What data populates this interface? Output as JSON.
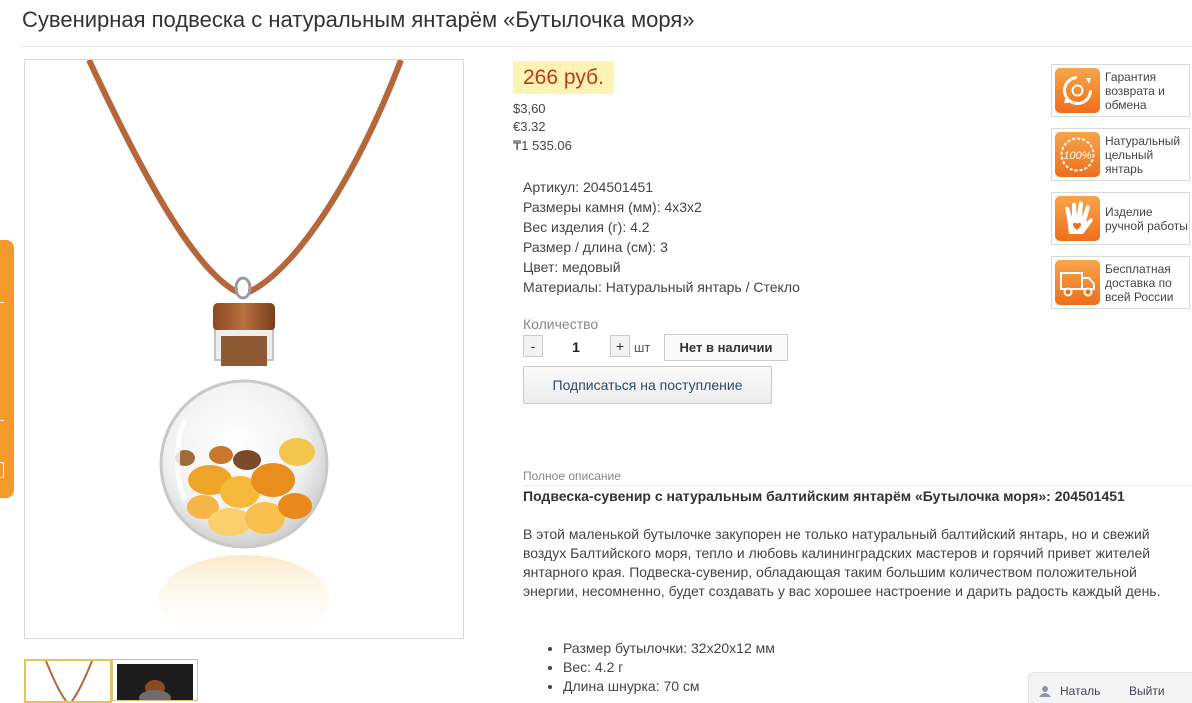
{
  "title": "Сувенирная подвеска с натуральным янтарём «Бутылочка моря»",
  "price": {
    "main": "266 руб.",
    "usd": "$3,60",
    "eur": "€3.32",
    "kzt": "₸1 535.06"
  },
  "specs": [
    "Артикул: 204501451",
    "Размеры камня (мм): 4х3х2",
    "Вес изделия (г): 4.2",
    "Размер / длина (см): 3",
    "Цвет: медовый",
    "Материалы: Натуральный янтарь / Стекло"
  ],
  "quantity": {
    "label": "Количество",
    "minus": "-",
    "value": "1",
    "plus": "+",
    "unit": "шт",
    "stock": "Нет в наличии"
  },
  "subscribe_label": "Подписаться на поступление",
  "badges": [
    {
      "icon": "return-icon",
      "lines": [
        "Гарантия",
        "возврата и",
        "обмена"
      ]
    },
    {
      "icon": "hundred-percent-icon",
      "lines": [
        "Натуральный",
        "цельный",
        "янтарь"
      ]
    },
    {
      "icon": "hand-icon",
      "lines": [
        "Изделие",
        "ручной работы"
      ]
    },
    {
      "icon": "truck-icon",
      "lines": [
        "Бесплатная",
        "доставка по",
        "всей России"
      ]
    }
  ],
  "description": {
    "label": "Полное описание",
    "heading": "Подвеска-сувенир с натуральным балтийским янтарём «Бутылочка моря»: 204501451",
    "body": "В этой маленькой бутылочке закупорен не только натуральный балтийский янтарь, но и свежий воздух Балтийского моря, тепло и любовь калининградских мастеров и горячий привет жителей янтарного края. Подвеска-сувенир, обладающая таким большим количеством положительной энергии, несомненно, будет создавать у вас хорошее настроение и дарить радость каждый день.",
    "list": [
      "Размер бутылочки: 32х20х12 мм",
      "Вес: 4.2 г",
      "Длина шнурка: 70 см"
    ]
  },
  "user_bar": {
    "name": "Наталь",
    "exit": "Выйти"
  },
  "colors": {
    "price_red": "#c0391b",
    "price_bg": "#fdf3b5",
    "badge_orange": "#f08a2a"
  }
}
